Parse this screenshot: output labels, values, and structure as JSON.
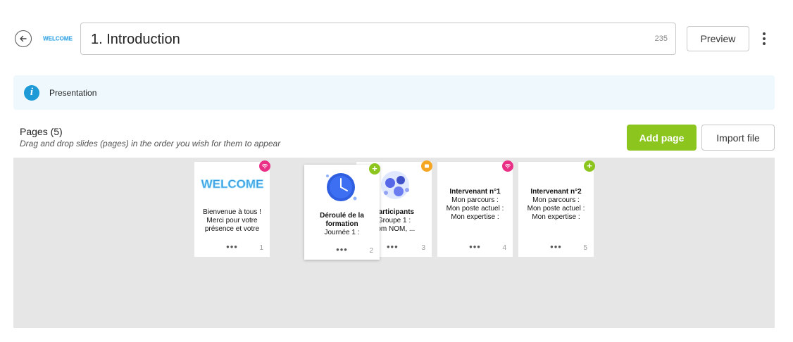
{
  "header": {
    "title_value": "1. Introduction",
    "char_count": "235",
    "preview_label": "Preview"
  },
  "info_bar": {
    "icon_glyph": "i",
    "text": "Presentation",
    "icon_color": "#1e9ad6"
  },
  "pages": {
    "title": "Pages (5)",
    "subtitle": "Drag and drop slides (pages) in the order you wish for them to appear",
    "add_label": "Add page",
    "import_label": "Import file",
    "accent_color": "#8bc51e"
  },
  "slides": [
    {
      "number": "1",
      "badge": "pink-wifi-icon",
      "lines": [
        "Bienvenue à tous !",
        "Merci pour votre",
        "présence et votre"
      ],
      "more": "•••"
    },
    {
      "number": "2",
      "badge": "green-plus-icon",
      "lines": [
        "Déroulé de la",
        "formation",
        "Journée 1 :"
      ],
      "more": "•••"
    },
    {
      "number": "3",
      "badge": "orange-card-icon",
      "lines": [
        "Participants",
        "Groupe 1 :",
        "nom NOM, ..."
      ],
      "more": "•••"
    },
    {
      "number": "4",
      "badge": "pink-wifi-icon",
      "lines": [
        "Intervenant n°1",
        "Mon parcours :",
        "Mon poste actuel :",
        "Mon expertise :"
      ],
      "more": "•••"
    },
    {
      "number": "5",
      "badge": "green-plus-icon",
      "lines": [
        "Intervenant n°2",
        "Mon parcours :",
        "Mon poste actuel :",
        "Mon expertise :"
      ],
      "more": "•••"
    }
  ]
}
